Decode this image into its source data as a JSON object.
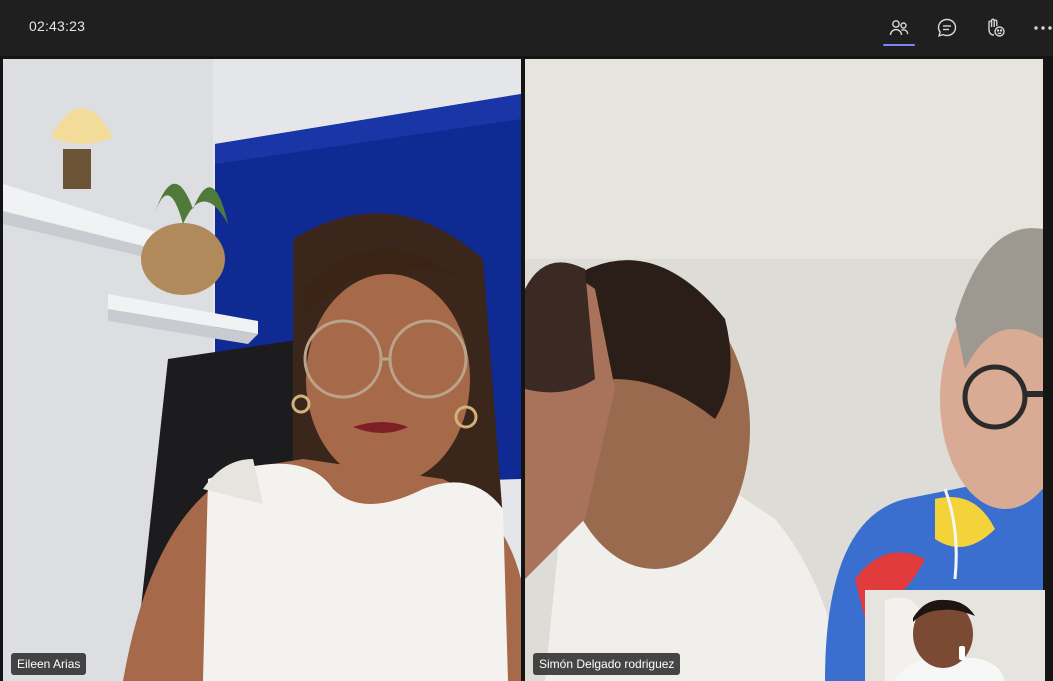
{
  "header": {
    "timer": "02:43:23",
    "buttons": [
      {
        "icon": "people-icon",
        "active": true
      },
      {
        "icon": "chat-icon",
        "active": false
      },
      {
        "icon": "reactions-icon",
        "active": false
      },
      {
        "icon": "more-options-icon",
        "active": false
      }
    ]
  },
  "participants": [
    {
      "name": "Eileen Arias"
    },
    {
      "name": "Simón Delgado rodriguez"
    }
  ],
  "colors": {
    "accent": "#7f85f5",
    "background": "#1f1f1f",
    "name_tag": "#202020"
  }
}
